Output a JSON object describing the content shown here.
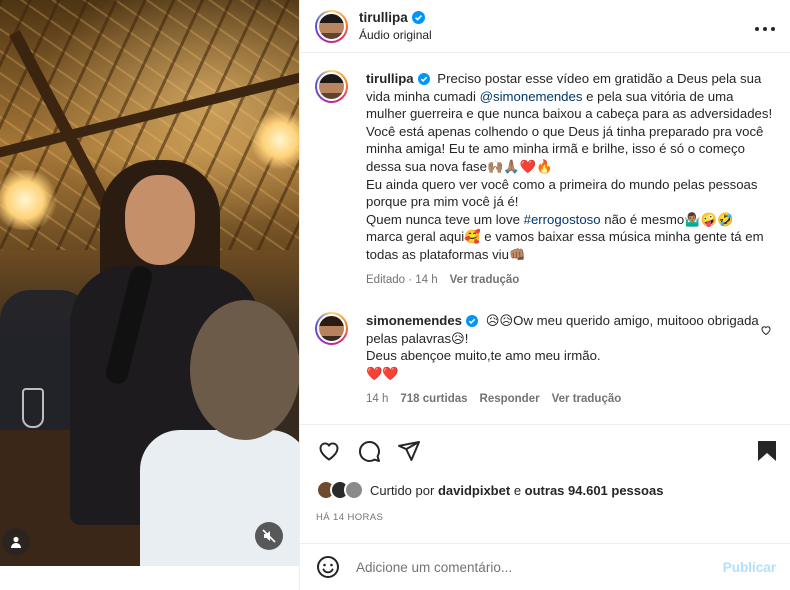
{
  "post": {
    "author": "tirullipa",
    "subtitle": "Áudio original",
    "more_icon": "more-horizontal-icon"
  },
  "caption": {
    "author": "tirullipa",
    "text_1": "Preciso postar esse vídeo em gratidão a Deus pela sua vida minha cumadi ",
    "mention": "@simonemendes",
    "text_2": " e pela sua vitória de uma mulher guerreira e que nunca baixou a cabeça para as adversidades! Você está apenas colhendo o que Deus já tinha preparado pra você minha amiga! Eu te amo minha irmã e brilhe, isso é só o começo dessa sua nova fase🙌🏽🙏🏽❤️🔥",
    "text_3": "Eu ainda quero ver você como a primeira do mundo pelas pessoas porque pra mim você já é!",
    "text_4a": "Quem nunca teve um love ",
    "hashtag": "#errogostoso",
    "text_4b": " não é mesmo🤷🏽‍♂️🤪🤣",
    "text_5": "marca geral aqui🥰 e vamos baixar essa música minha gente tá em todas as plataformas viu👊🏽",
    "status": "Editado",
    "time": "14 h",
    "see_translation": "Ver tradução"
  },
  "reply": {
    "author": "simonemendes",
    "line_1": "😥😥Ow meu querido amigo, muitooo obrigada pelas palavras😥!",
    "line_2": "Deus abençoe muito,te amo meu irmão.",
    "line_3": "❤️❤️",
    "time": "14 h",
    "likes": "718 curtidas",
    "reply_label": "Responder",
    "see_translation": "Ver tradução"
  },
  "likes": {
    "prefix": "Curtido por",
    "user": "davidpixbet",
    "connector": "e",
    "others": "outras 94.601 pessoas"
  },
  "timestamp": "HÁ 14 HORAS",
  "add_comment": {
    "placeholder": "Adicione um comentário...",
    "publish": "Publicar"
  }
}
